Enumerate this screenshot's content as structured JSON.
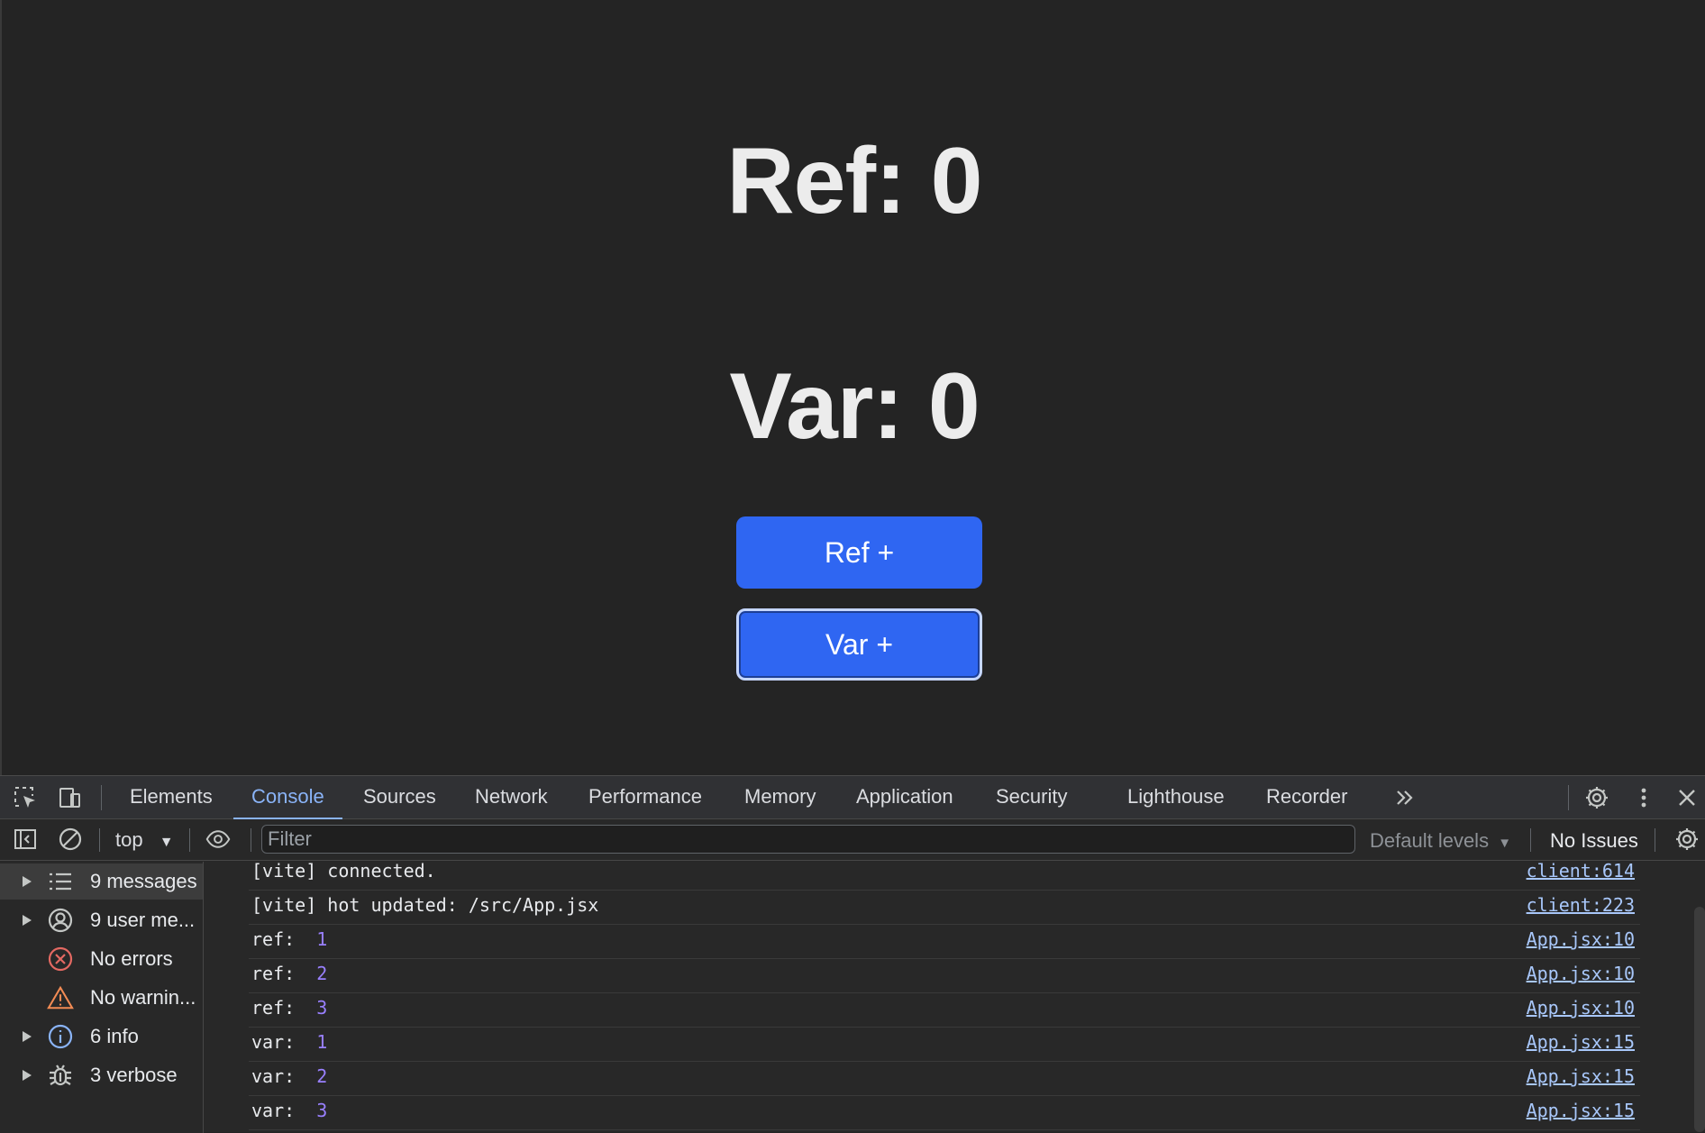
{
  "app": {
    "ref_label": "Ref: 0",
    "var_label": "Var: 0",
    "ref_button": "Ref +",
    "var_button": "Var +",
    "button_color": "#2f66f2"
  },
  "devtools": {
    "tabs": [
      "Elements",
      "Console",
      "Sources",
      "Network",
      "Performance",
      "Memory",
      "Application",
      "Security",
      "Lighthouse",
      "Recorder"
    ],
    "active_tab": "Console",
    "more_tabs_icon": "chevron-double-right-icon",
    "filter": {
      "context": "top",
      "placeholder": "Filter",
      "levels": "Default levels",
      "issues": "No Issues"
    },
    "sidebar": [
      {
        "label": "9 messages",
        "icon": "list-icon"
      },
      {
        "label": "9 user me...",
        "icon": "user-icon"
      },
      {
        "label": "No errors",
        "icon": "error-icon"
      },
      {
        "label": "No warnin...",
        "icon": "warning-icon"
      },
      {
        "label": "6 info",
        "icon": "info-icon"
      },
      {
        "label": "3 verbose",
        "icon": "bug-icon"
      }
    ],
    "log": [
      {
        "text": "[vite] connected.",
        "value": "",
        "source": "client:614"
      },
      {
        "text": "[vite] hot updated: /src/App.jsx",
        "value": "",
        "source": "client:223"
      },
      {
        "text": "ref:  ",
        "value": "1",
        "source": "App.jsx:10"
      },
      {
        "text": "ref:  ",
        "value": "2",
        "source": "App.jsx:10"
      },
      {
        "text": "ref:  ",
        "value": "3",
        "source": "App.jsx:10"
      },
      {
        "text": "var:  ",
        "value": "1",
        "source": "App.jsx:15"
      },
      {
        "text": "var:  ",
        "value": "2",
        "source": "App.jsx:15"
      },
      {
        "text": "var:  ",
        "value": "3",
        "source": "App.jsx:15"
      }
    ]
  }
}
